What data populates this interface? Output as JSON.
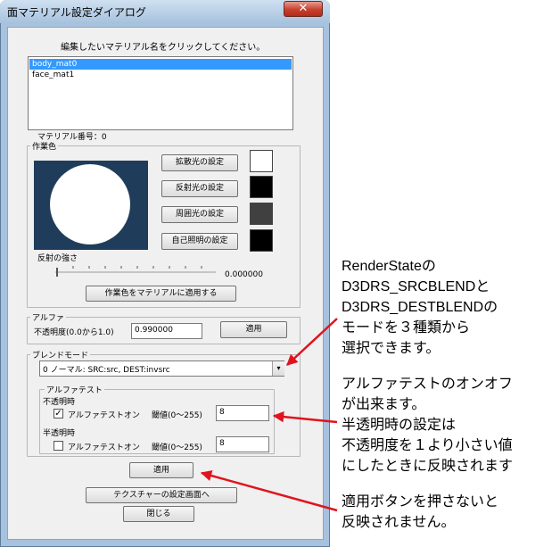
{
  "window": {
    "title": "面マテリアル設定ダイアログ",
    "close_glyph": "✕"
  },
  "instruction": "編集したいマテリアル名をクリックしてください。",
  "materials": {
    "items": [
      "body_mat0",
      "face_mat1"
    ],
    "selected_index": 0
  },
  "material_number": "マテリアル番号：0",
  "work_color": {
    "group_title": "作業色",
    "diffuse_button": "拡散光の設定",
    "specular_button": "反射光の設定",
    "ambient_button": "周囲光の設定",
    "emissive_button": "自己照明の設定",
    "colors": {
      "diffuse": "#ffffff",
      "specular": "#000000",
      "ambient": "#404040",
      "emissive": "#000000",
      "preview_bg": "#1f3d5a"
    },
    "reflect_label": "反射の強さ",
    "reflect_value": "0.000000",
    "apply_button": "作業色をマテリアルに適用する"
  },
  "alpha": {
    "group_title": "アルファ",
    "label": "不透明度(0.0から1.0)",
    "value": "0.990000",
    "apply_button": "適用"
  },
  "blend": {
    "group_title": "ブレンドモード",
    "selected": "0 ノーマル: SRC:src, DEST:invsrc",
    "arrow": "▾"
  },
  "alpha_test": {
    "group_title": "アルファテスト",
    "opaque_label": "不透明時",
    "opaque_checkbox_label": "アルファテストオン",
    "opaque_checked": true,
    "opaque_check_glyph": "✓",
    "opaque_threshold_label": "閾値(0〜255)",
    "opaque_threshold_value": "8",
    "translucent_label": "半透明時",
    "translucent_checkbox_label": "アルファテストオン",
    "translucent_checked": false,
    "translucent_threshold_label": "閾値(0〜255)",
    "translucent_threshold_value": "8"
  },
  "apply_button": "適用",
  "texture_button": "テクスチャーの設定画面へ",
  "close_button": "閉じる",
  "annotations": {
    "blend_note": [
      "RenderStateの",
      "D3DRS_SRCBLENDと",
      "D3DRS_DESTBLENDの",
      "モードを３種類から",
      "選択できます。"
    ],
    "alpha_test_note": [
      "アルファテストのオンオフ",
      "が出来ます。",
      "半透明時の設定は",
      "不透明度を１より小さい値",
      "にしたときに反映されます"
    ],
    "apply_note": [
      "適用ボタンを押さないと",
      "反映されません。"
    ],
    "arrow_color": "#e0141e"
  }
}
